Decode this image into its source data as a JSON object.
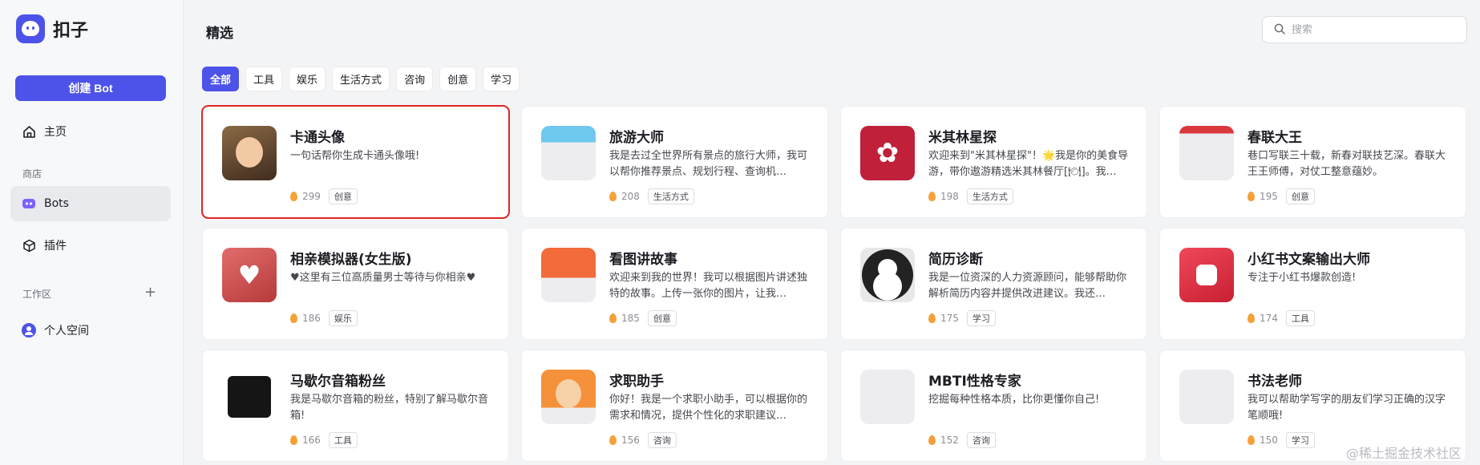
{
  "brand": {
    "name": "扣子"
  },
  "sidebar": {
    "create_label": "创建 Bot",
    "home_label": "主页",
    "store_section": "商店",
    "bots_label": "Bots",
    "plugins_label": "插件",
    "workspace_section": "工作区",
    "workspace_add": "+",
    "personal_label": "个人空间"
  },
  "main": {
    "title": "精选",
    "search_placeholder": "搜索",
    "tabs": [
      "全部",
      "工具",
      "娱乐",
      "生活方式",
      "咨询",
      "创意",
      "学习"
    ]
  },
  "cards": [
    {
      "title": "卡通头像",
      "desc": "一句话帮你生成卡通头像哦!",
      "count": "299",
      "tag": "创意",
      "art": "cartoon",
      "highlight": true
    },
    {
      "title": "旅游大师",
      "desc": "我是去过全世界所有景点的旅行大师，我可以帮你推荐景点、规划行程、查询机…",
      "count": "208",
      "tag": "生活方式",
      "art": "travel"
    },
    {
      "title": "米其林星探",
      "desc": "欢迎来到\"米其林星探\"！🌟我是你的美食导游，带你遨游精选米其林餐厅[🍽]。我…",
      "count": "198",
      "tag": "生活方式",
      "art": "mich"
    },
    {
      "title": "春联大王",
      "desc": "巷口写联三十载，新春对联技艺深。春联大王王师傅，对仗工整意蕴妙。",
      "count": "195",
      "tag": "创意",
      "art": "spring"
    },
    {
      "title": "相亲模拟器(女生版)",
      "desc": "♥这里有三位高质量男士等待与你相亲♥",
      "count": "186",
      "tag": "娱乐",
      "art": "date"
    },
    {
      "title": "看图讲故事",
      "desc": "欢迎来到我的世界！我可以根据图片讲述独特的故事。上传一张你的图片，让我…",
      "count": "185",
      "tag": "创意",
      "art": "story"
    },
    {
      "title": "简历诊断",
      "desc": "我是一位资深的人力资源顾问，能够帮助你解析简历内容并提供改进建议。我还…",
      "count": "175",
      "tag": "学习",
      "art": "cv"
    },
    {
      "title": "小红书文案输出大师",
      "desc": "专注于小红书爆款创造!",
      "count": "174",
      "tag": "工具",
      "art": "xhs"
    },
    {
      "title": "马歇尔音箱粉丝",
      "desc": "我是马歇尔音箱的粉丝，特别了解马歇尔音箱!",
      "count": "166",
      "tag": "工具",
      "art": "speaker"
    },
    {
      "title": "求职助手",
      "desc": "你好！我是一个求职小助手，可以根据你的需求和情况，提供个性化的求职建议…",
      "count": "156",
      "tag": "咨询",
      "art": "job"
    },
    {
      "title": "MBTI性格专家",
      "desc": "挖掘每种性格本质，比你更懂你自己!",
      "count": "152",
      "tag": "咨询",
      "art": "blank"
    },
    {
      "title": "书法老师",
      "desc": "我可以帮助学写字的朋友们学习正确的汉字笔顺哦!",
      "count": "150",
      "tag": "学习",
      "art": "blank"
    }
  ],
  "watermark": "@稀土掘金技术社区",
  "colors": {
    "accent": "#4d53e8",
    "highlight": "#e02424",
    "flame": "#f4a13a"
  }
}
